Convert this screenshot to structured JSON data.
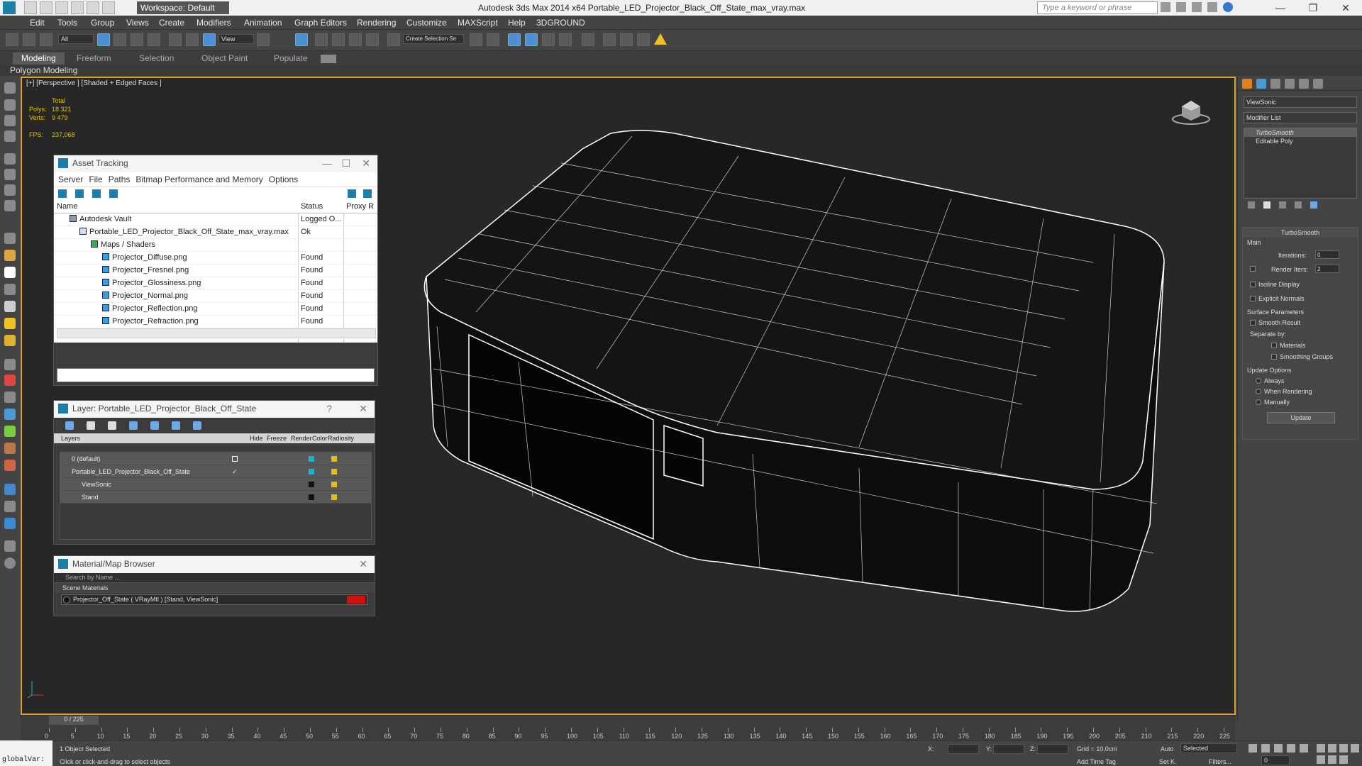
{
  "window": {
    "workspace": "Workspace: Default",
    "title": "Autodesk 3ds Max  2014 x64      Portable_LED_Projector_Black_Off_State_max_vray.max",
    "search_placeholder": "Type a keyword or phrase"
  },
  "menu": [
    "Edit",
    "Tools",
    "Group",
    "Views",
    "Create",
    "Modifiers",
    "Animation",
    "Graph Editors",
    "Rendering",
    "Customize",
    "MAXScript",
    "Help",
    "3DGROUND"
  ],
  "toolbar": {
    "filter": "All",
    "refcoord": "View",
    "selection_set": "Create Selection Se"
  },
  "ribbon": {
    "tabs": [
      "Modeling",
      "Freeform",
      "Selection",
      "Object Paint",
      "Populate"
    ],
    "subtitle": "Polygon Modeling"
  },
  "viewport": {
    "label": "[+] [Perspective ] [Shaded + Edged Faces ]",
    "stats": {
      "total_label": "Total",
      "polys_label": "Polys:",
      "polys": "18 321",
      "verts_label": "Verts:",
      "verts": "9 479",
      "fps_label": "FPS:",
      "fps": "237,068"
    }
  },
  "asset_tracking": {
    "title": "Asset Tracking",
    "menu": [
      "Server",
      "File",
      "Paths",
      "Bitmap Performance and Memory",
      "Options"
    ],
    "columns": [
      "Name",
      "Status",
      "Proxy R"
    ],
    "rows": [
      {
        "name": "Autodesk Vault",
        "status": "Logged O..."
      },
      {
        "name": "Portable_LED_Projector_Black_Off_State_max_vray.max",
        "status": "Ok"
      },
      {
        "name": "Maps / Shaders",
        "status": ""
      },
      {
        "name": "Projector_Diffuse.png",
        "status": "Found"
      },
      {
        "name": "Projector_Fresnel.png",
        "status": "Found"
      },
      {
        "name": "Projector_Glossiness.png",
        "status": "Found"
      },
      {
        "name": "Projector_Normal.png",
        "status": "Found"
      },
      {
        "name": "Projector_Reflection.png",
        "status": "Found"
      },
      {
        "name": "Projector_Refraction.png",
        "status": "Found"
      }
    ]
  },
  "layer_panel": {
    "title": "Layer: Portable_LED_Projector_Black_Off_State",
    "help": "?",
    "columns": [
      "Layers",
      "Hide",
      "Freeze",
      "Render",
      "Color",
      "Radiosity"
    ],
    "rows": [
      {
        "name": "0 (default)",
        "color": "#18b4c8"
      },
      {
        "name": "Portable_LED_Projector_Black_Off_State",
        "color": "#18b4c8"
      },
      {
        "name": "ViewSonic",
        "color": "#111111"
      },
      {
        "name": "Stand",
        "color": "#111111"
      }
    ]
  },
  "material_browser": {
    "title": "Material/Map Browser",
    "search_placeholder": "Search by Name ...",
    "group": "Scene Materials",
    "item": "Projector_Off_State  ( VRayMtl ) [Stand, ViewSonic]"
  },
  "command_panel": {
    "object_name": "ViewSonic",
    "modifier_list": "Modifier List",
    "stack": [
      "TurboSmooth",
      "Editable Poly"
    ],
    "rollout_title": "TurboSmooth",
    "main_label": "Main",
    "iterations_label": "Iterations:",
    "iterations": "0",
    "render_iters_label": "Render Iters:",
    "render_iters": "2",
    "isoline": "Isoline Display",
    "explicit_normals": "Explicit Normals",
    "surface_params": "Surface Parameters",
    "smooth_result": "Smooth Result",
    "separate_by": "Separate by:",
    "materials": "Materials",
    "smoothing_groups": "Smoothing Groups",
    "update_options": "Update Options",
    "always": "Always",
    "when_rendering": "When Rendering",
    "manually": "Manually",
    "update_button": "Update"
  },
  "timeline": {
    "frame": "0 / 225",
    "ticks": [
      "0",
      "5",
      "10",
      "15",
      "20",
      "25",
      "30",
      "35",
      "40",
      "45",
      "50",
      "55",
      "60",
      "65",
      "70",
      "75",
      "80",
      "85",
      "90",
      "95",
      "100",
      "105",
      "110",
      "115",
      "120",
      "125",
      "130",
      "135",
      "140",
      "145",
      "150",
      "155",
      "160",
      "165",
      "170",
      "175",
      "180",
      "185",
      "190",
      "195",
      "200",
      "205",
      "210",
      "215",
      "220",
      "225"
    ]
  },
  "status": {
    "maxscript": "globalVar:",
    "selected": "1 Object Selected",
    "prompt": "Click or click-and-drag to select objects",
    "x_label": "X:",
    "y_label": "Y:",
    "z_label": "Z:",
    "grid": "Grid = 10,0cm",
    "auto": "Auto",
    "selected_dropdown": "Selected",
    "set_key": "Set K.",
    "filters": "Filters...",
    "add_time_tag": "Add Time Tag",
    "frame_field": "0"
  }
}
